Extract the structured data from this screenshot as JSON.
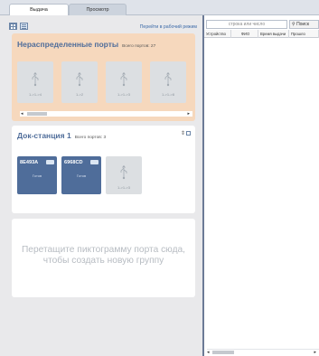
{
  "tabs": [
    {
      "label": "Выдача",
      "active": true
    },
    {
      "label": "Просмотр",
      "active": false
    }
  ],
  "toolbar": {
    "work_mode_link": "Перейти в рабочий режим"
  },
  "unassigned": {
    "title": "Нераспределенные порты",
    "count_text": "Всего портов: 27",
    "ports": [
      {
        "label": "1->1->4"
      },
      {
        "label": "1->2"
      },
      {
        "label": "1->1->3"
      },
      {
        "label": "1->1->8"
      }
    ]
  },
  "dock": {
    "title": "Док-станция 1",
    "count_text": "Всего портов: 3",
    "devices": [
      {
        "name": "8E493A",
        "state": "Готов"
      },
      {
        "name": "6968CD",
        "state": "Готов"
      }
    ],
    "empty_port_label": "1->1->3"
  },
  "dropzone": {
    "line1": "Перетащите пиктограмму порта сюда,",
    "line2": "чтобы создать новую группу"
  },
  "right_panel": {
    "search_placeholder": "строка или число",
    "search_button": "Поиск",
    "columns": [
      "Устройство",
      "ФИО",
      "Время выдачи",
      "Прошло"
    ]
  },
  "colors": {
    "accent": "#4f6d9a",
    "unassigned_bg": "#f6d8bd",
    "panel_bg": "#e9e9eb",
    "divider": "#6c7a96"
  }
}
